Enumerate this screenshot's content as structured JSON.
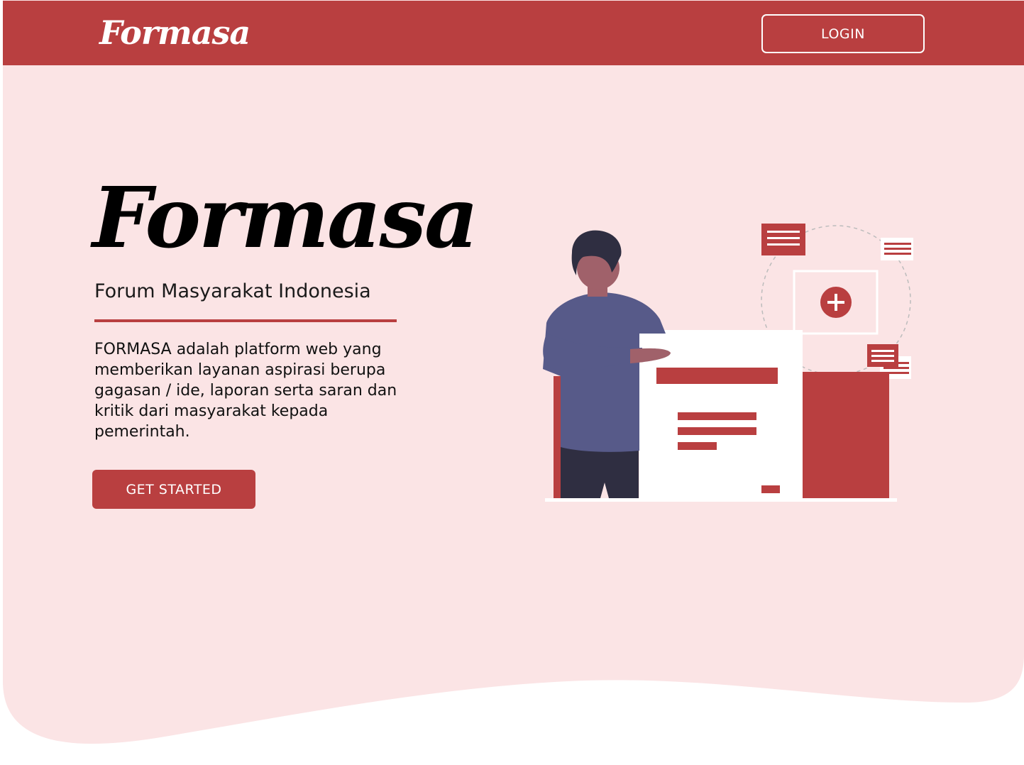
{
  "header": {
    "logo_text": "Formasa",
    "login_label": "LOGIN"
  },
  "hero": {
    "title": "Formasa",
    "subtitle": "Forum Masyarakat Indonesia",
    "description": "FORMASA adalah platform web yang memberikan layanan aspirasi berupa gagasan / ide, laporan serta saran dan kritik dari masyarakat kepada pemerintah.",
    "cta_label": "GET STARTED"
  },
  "colors": {
    "brand": "#b93f40",
    "hero_background": "#fbe4e5",
    "text": "#111111"
  },
  "icons": {
    "add": "plus-circle-icon"
  }
}
